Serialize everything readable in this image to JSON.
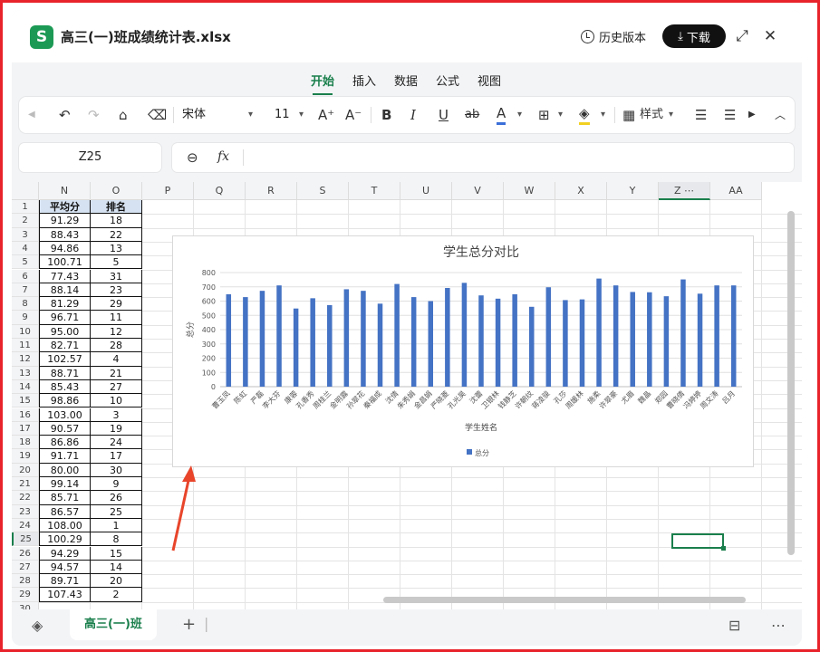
{
  "app": {
    "logo_letter": "S",
    "doc_title": "高三(一)班成绩统计表.xlsx"
  },
  "titlebar": {
    "history_label": "历史版本",
    "download_label": "下载"
  },
  "menu": {
    "tabs": [
      "开始",
      "插入",
      "数据",
      "公式",
      "视图"
    ],
    "active": "开始"
  },
  "toolbar": {
    "font_name": "宋体",
    "font_size": "11",
    "style_label": "样式"
  },
  "formula_bar": {
    "cell_ref": "Z25",
    "fx_label": "fx",
    "formula": ""
  },
  "columns": [
    "N",
    "O",
    "P",
    "Q",
    "R",
    "S",
    "T",
    "U",
    "V",
    "W",
    "X",
    "Y",
    "Z",
    "AA"
  ],
  "selected_column": "Z",
  "rows": [
    "1",
    "2",
    "3",
    "4",
    "5",
    "6",
    "7",
    "8",
    "9",
    "10",
    "11",
    "12",
    "13",
    "14",
    "15",
    "16",
    "17",
    "18",
    "19",
    "20",
    "21",
    "22",
    "23",
    "24",
    "25",
    "26",
    "27",
    "28",
    "29",
    "30"
  ],
  "selected_row": "25",
  "table": {
    "headers": [
      "平均分",
      "排名"
    ],
    "rows": [
      [
        "91.29",
        "18"
      ],
      [
        "88.43",
        "22"
      ],
      [
        "94.86",
        "13"
      ],
      [
        "100.71",
        "5"
      ],
      [
        "77.43",
        "31"
      ],
      [
        "88.14",
        "23"
      ],
      [
        "81.29",
        "29"
      ],
      [
        "96.71",
        "11"
      ],
      [
        "95.00",
        "12"
      ],
      [
        "82.71",
        "28"
      ],
      [
        "102.57",
        "4"
      ],
      [
        "88.71",
        "21"
      ],
      [
        "85.43",
        "27"
      ],
      [
        "98.86",
        "10"
      ],
      [
        "103.00",
        "3"
      ],
      [
        "90.57",
        "19"
      ],
      [
        "86.86",
        "24"
      ],
      [
        "91.71",
        "17"
      ],
      [
        "80.00",
        "30"
      ],
      [
        "99.14",
        "9"
      ],
      [
        "85.71",
        "26"
      ],
      [
        "86.57",
        "25"
      ],
      [
        "108.00",
        "1"
      ],
      [
        "100.29",
        "8"
      ],
      [
        "94.29",
        "15"
      ],
      [
        "94.57",
        "14"
      ],
      [
        "89.71",
        "20"
      ],
      [
        "107.43",
        "2"
      ]
    ]
  },
  "chart_data": {
    "type": "bar",
    "title": "学生总分对比",
    "xlabel": "学生姓名",
    "ylabel": "总分",
    "ylim": [
      0,
      800
    ],
    "yticks": [
      0,
      100,
      200,
      300,
      400,
      500,
      600,
      700,
      800
    ],
    "grid": true,
    "legend": "bottom",
    "color": "#4472c4",
    "categories": [
      "曹玉凤",
      "陈虹",
      "严磊",
      "李大芬",
      "康蓉",
      "孔香秀",
      "周桂兰",
      "金明露",
      "孙翠花",
      "秦福成",
      "沈倩",
      "朱秀娟",
      "金昌娟",
      "严晓菱",
      "孔光昊",
      "沈蕾",
      "卫银林",
      "钱静芝",
      "许朝纹",
      "蒋凌骏",
      "孔莎",
      "周媛林",
      "施柔",
      "许翠豪",
      "尤眉",
      "魏晶",
      "郑园",
      "曹晓倩",
      "冯婷婷",
      "周文涛",
      "吕月"
    ],
    "series": [
      {
        "name": "总分",
        "values": [
          648,
          628,
          672,
          710,
          548,
          620,
          572,
          683,
          672,
          582,
          720,
          628,
          600,
          692,
          728,
          640,
          617,
          648,
          560,
          697,
          607,
          612,
          758,
          710,
          664,
          662,
          634,
          752,
          652,
          710,
          710
        ]
      }
    ]
  },
  "sheet_tab": "高三(一)班"
}
